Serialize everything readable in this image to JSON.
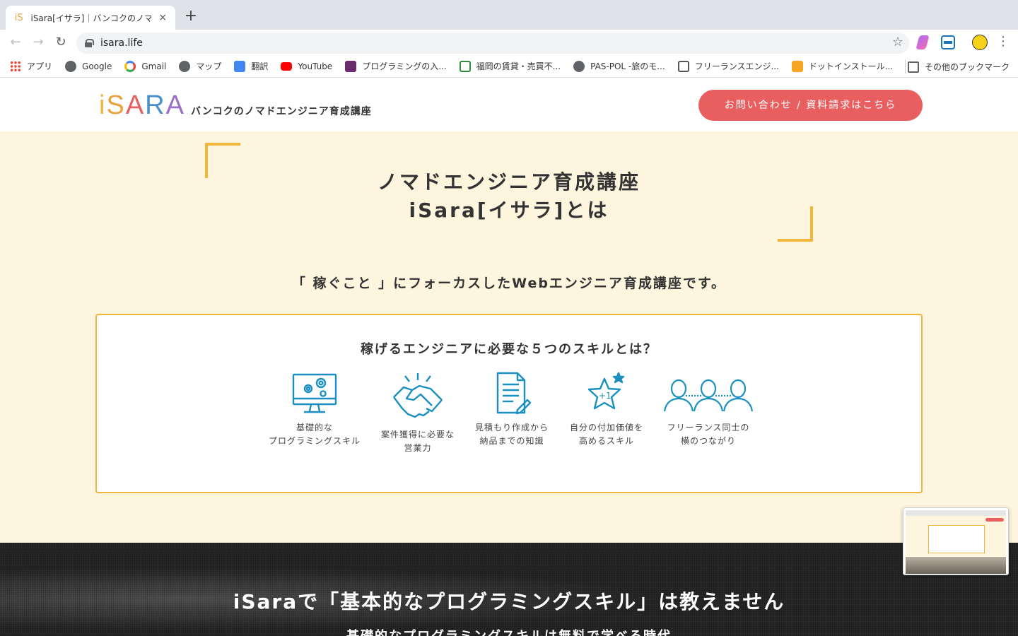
{
  "browser": {
    "tab_title": "iSara[イサラ]｜バンコクのノマドエンジニア育成講座",
    "tab_favicon": "iS",
    "tab_close": "×",
    "new_tab": "+",
    "url": "isara.life",
    "nav": {
      "back": "←",
      "forward": "→",
      "reload": "↻",
      "star": "☆",
      "menu": "⋮"
    },
    "bookmarks": [
      {
        "label": "アプリ",
        "icon": "apps-grid-icon"
      },
      {
        "label": "Google",
        "icon": "globe-icon"
      },
      {
        "label": "Gmail",
        "icon": "google-icon"
      },
      {
        "label": "マップ",
        "icon": "globe-icon"
      },
      {
        "label": "翻訳",
        "icon": "translate-icon"
      },
      {
        "label": "YouTube",
        "icon": "youtube-icon"
      },
      {
        "label": "プログラミングの入...",
        "icon": "progate-icon"
      },
      {
        "label": "福岡の賃貸・売買不...",
        "icon": "house-icon"
      },
      {
        "label": "PAS-POL -旅のモ...",
        "icon": "globe-icon"
      },
      {
        "label": "フリーランスエンジ...",
        "icon": "home-icon"
      },
      {
        "label": "ドットインストール...",
        "icon": "dotinstall-icon"
      }
    ],
    "other_bookmarks": "その他のブックマーク"
  },
  "header": {
    "logo": [
      "i",
      "S",
      "A",
      "R",
      "A"
    ],
    "logo_colors": [
      "#f0b53a",
      "#e8a33c",
      "#e95f5f",
      "#4a90c8",
      "#9b6fc7"
    ],
    "tagline": "バンコクのノマドエンジニア育成講座",
    "contact_button": "お問い合わせ / 資料請求はこちら"
  },
  "intro": {
    "title_line1": "ノマドエンジニア育成講座",
    "title_line2": "iSara[イサラ]とは",
    "subtitle": "「 稼ぐこと 」にフォーカスしたWebエンジニア育成講座です。",
    "skills_title": "稼げるエンジニアに必要な５つのスキルとは？",
    "skills": [
      {
        "label": "基礎的な\nプログラミングスキル",
        "icon": "monitor-gears-icon"
      },
      {
        "label": "案件獲得に必要な\n営業力",
        "icon": "handshake-icon"
      },
      {
        "label": "見積もり作成から\n納品までの知識",
        "icon": "document-pen-icon"
      },
      {
        "label": "自分の付加価値を\n高めるスキル",
        "icon": "star-plus-one-icon"
      },
      {
        "label": "フリーランス同士の\n横のつながり",
        "icon": "people-network-icon"
      }
    ],
    "accent_color": "#f0b53a",
    "icon_color": "#1a8fc0"
  },
  "section2": {
    "title": "iSaraで「基本的なプログラミングスキル」は教えません",
    "subtitle": "基礎的なプログラミングスキルは無料で学べる時代"
  }
}
